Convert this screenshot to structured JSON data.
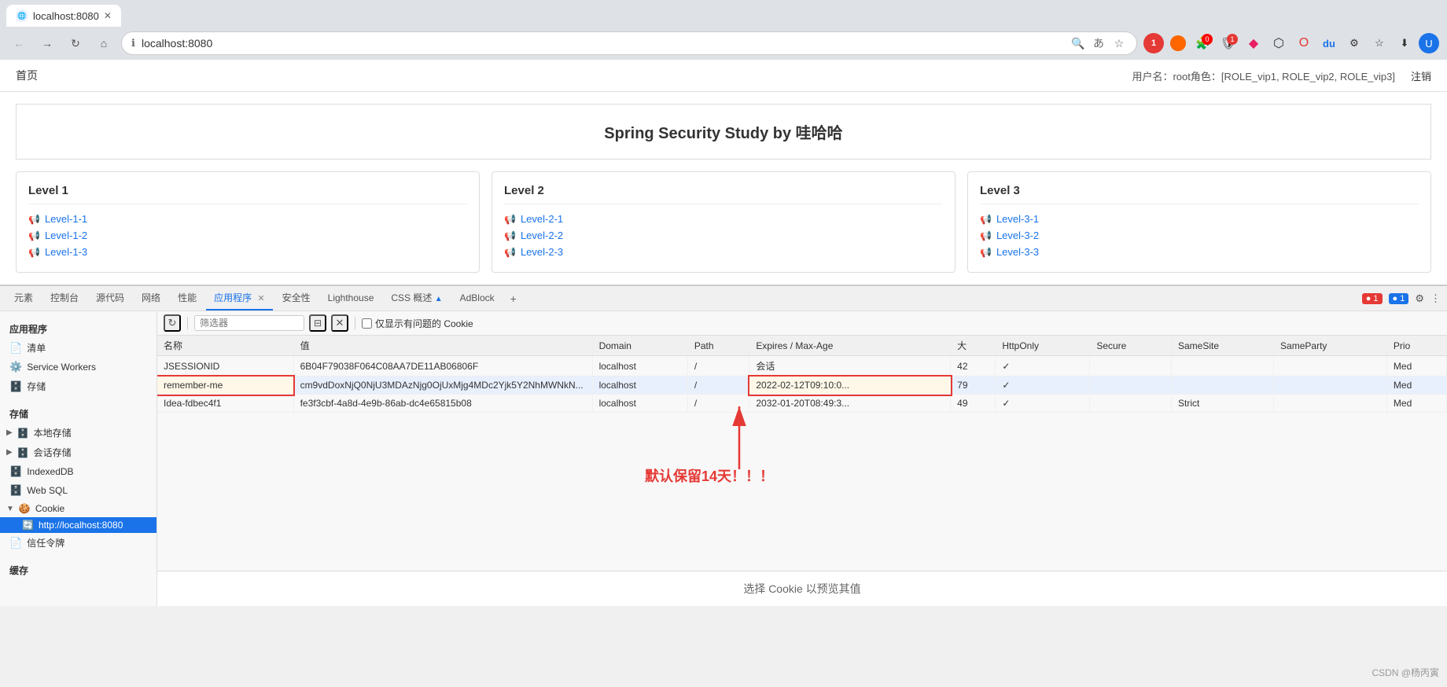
{
  "browser": {
    "url": "localhost:8080",
    "tab_title": "localhost:8080"
  },
  "page": {
    "header": {
      "home_link": "首页",
      "user_info": "用户名：root角色：[ROLE_vip1, ROLE_vip2, ROLE_vip3]",
      "logout": "注销"
    },
    "hero_title": "Spring Security Study by 哇哈哈",
    "level_cards": [
      {
        "title": "Level 1",
        "items": [
          "Level-1-1",
          "Level-1-2",
          "Level-1-3"
        ]
      },
      {
        "title": "Level 2",
        "items": [
          "Level-2-1",
          "Level-2-2",
          "Level-2-3"
        ]
      },
      {
        "title": "Level 3",
        "items": [
          "Level-3-1",
          "Level-3-2",
          "Level-3-3"
        ]
      }
    ]
  },
  "devtools": {
    "tabs": [
      "元素",
      "控制台",
      "源代码",
      "网络",
      "性能",
      "应用程序",
      "安全性",
      "Lighthouse",
      "CSS 概述",
      "AdBlock"
    ],
    "active_tab": "应用程序",
    "tab_with_close": "应用程序",
    "badge_counts": {
      "red1": "1",
      "blue1": "1"
    }
  },
  "sidebar": {
    "app_section": "应用程序",
    "items": [
      {
        "label": "清单",
        "icon": "📄"
      },
      {
        "label": "Service Workers",
        "icon": "⚙️"
      },
      {
        "label": "存储",
        "icon": "🗄️"
      }
    ],
    "storage_section": "存储",
    "storage_items": [
      {
        "label": "本地存储",
        "icon": "🗄️",
        "expandable": true
      },
      {
        "label": "会话存储",
        "icon": "🗄️",
        "expandable": true
      },
      {
        "label": "IndexedDB",
        "icon": "🗄️",
        "expandable": false
      },
      {
        "label": "Web SQL",
        "icon": "🗄️",
        "expandable": false
      }
    ],
    "cookie_section": "Cookie",
    "cookie_items": [
      {
        "label": "http://localhost:8080",
        "active": true
      }
    ],
    "trust_section": "信任令牌",
    "bottom_section": "缓存"
  },
  "toolbar": {
    "refresh_title": "刷新",
    "filter_placeholder": "筛选器",
    "checkbox_label": "仅显示有问题的 Cookie"
  },
  "cookie_table": {
    "headers": [
      "名称",
      "值",
      "Domain",
      "Path",
      "Expires / Max-Age",
      "大",
      "HttpOnly",
      "Secure",
      "SameSite",
      "SameParty",
      "Prio"
    ],
    "rows": [
      {
        "name": "JSESSIONID",
        "value": "6B04F79038F064C08AA7DE11AB06806F",
        "domain": "localhost",
        "path": "/",
        "expires": "会话",
        "size": "42",
        "httponly": "✓",
        "secure": "",
        "samesite": "",
        "sameparty": "",
        "priority": "Med",
        "selected": false,
        "highlighted": false
      },
      {
        "name": "remember-me",
        "value": "cm9vdDoxNjQ0NjU3MDAzNjg0OjUxMjg4MDc2Yjk5Y2NhMWNkN...",
        "domain": "localhost",
        "path": "/",
        "expires": "2022-02-12T09:10:0...",
        "size": "79",
        "httponly": "✓",
        "secure": "",
        "samesite": "",
        "sameparty": "",
        "priority": "Med",
        "selected": true,
        "highlighted": true
      },
      {
        "name": "Idea-fdbec4f1",
        "value": "fe3f3cbf-4a8d-4e9b-86ab-dc4e65815b08",
        "domain": "localhost",
        "path": "/",
        "expires": "2032-01-20T08:49:3...",
        "size": "49",
        "httponly": "✓",
        "secure": "",
        "samesite": "Strict",
        "sameparty": "",
        "priority": "Med",
        "selected": false,
        "highlighted": false
      }
    ]
  },
  "annotation": {
    "text": "默认保留14天！！！"
  },
  "bottom_preview": {
    "text": "选择 Cookie 以预览其值"
  },
  "watermark": {
    "text": "CSDN @杨丙寅"
  }
}
